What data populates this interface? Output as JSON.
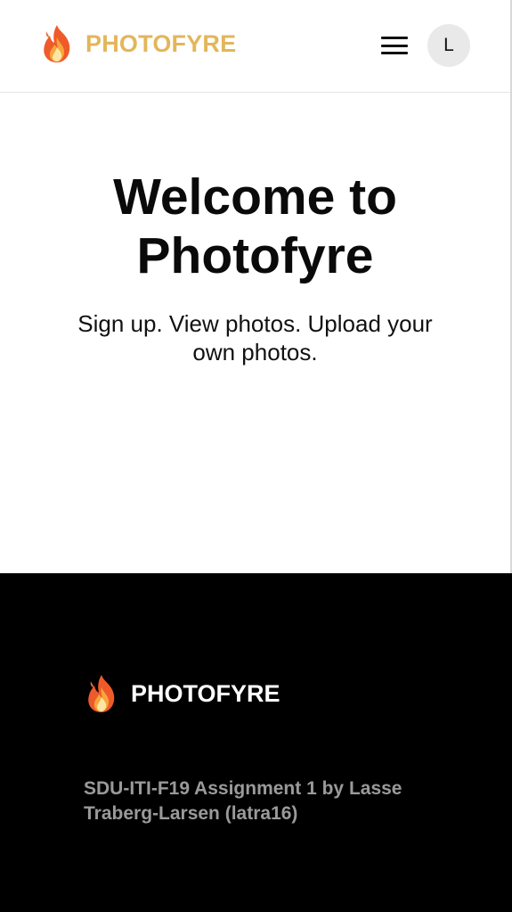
{
  "header": {
    "brand_name": "PHOTOFYRE",
    "logo_icon": "fire-icon",
    "menu_icon": "hamburger-menu-icon",
    "avatar_initial": "L"
  },
  "hero": {
    "title": "Welcome to Photofyre",
    "subtitle": "Sign up. View photos. Upload your own photos."
  },
  "footer": {
    "brand_name": "PHOTOFYRE",
    "logo_icon": "fire-icon",
    "credit": "SDU-ITI-F19 Assignment 1 by Lasse Traberg-Larsen (latra16)"
  },
  "colors": {
    "brand_accent": "#e2b65b",
    "header_bg": "#ffffff",
    "footer_bg": "#000000",
    "footer_text": "#ffffff",
    "footer_muted_text": "#9a9a9a",
    "avatar_bg": "#e9e9e9"
  }
}
